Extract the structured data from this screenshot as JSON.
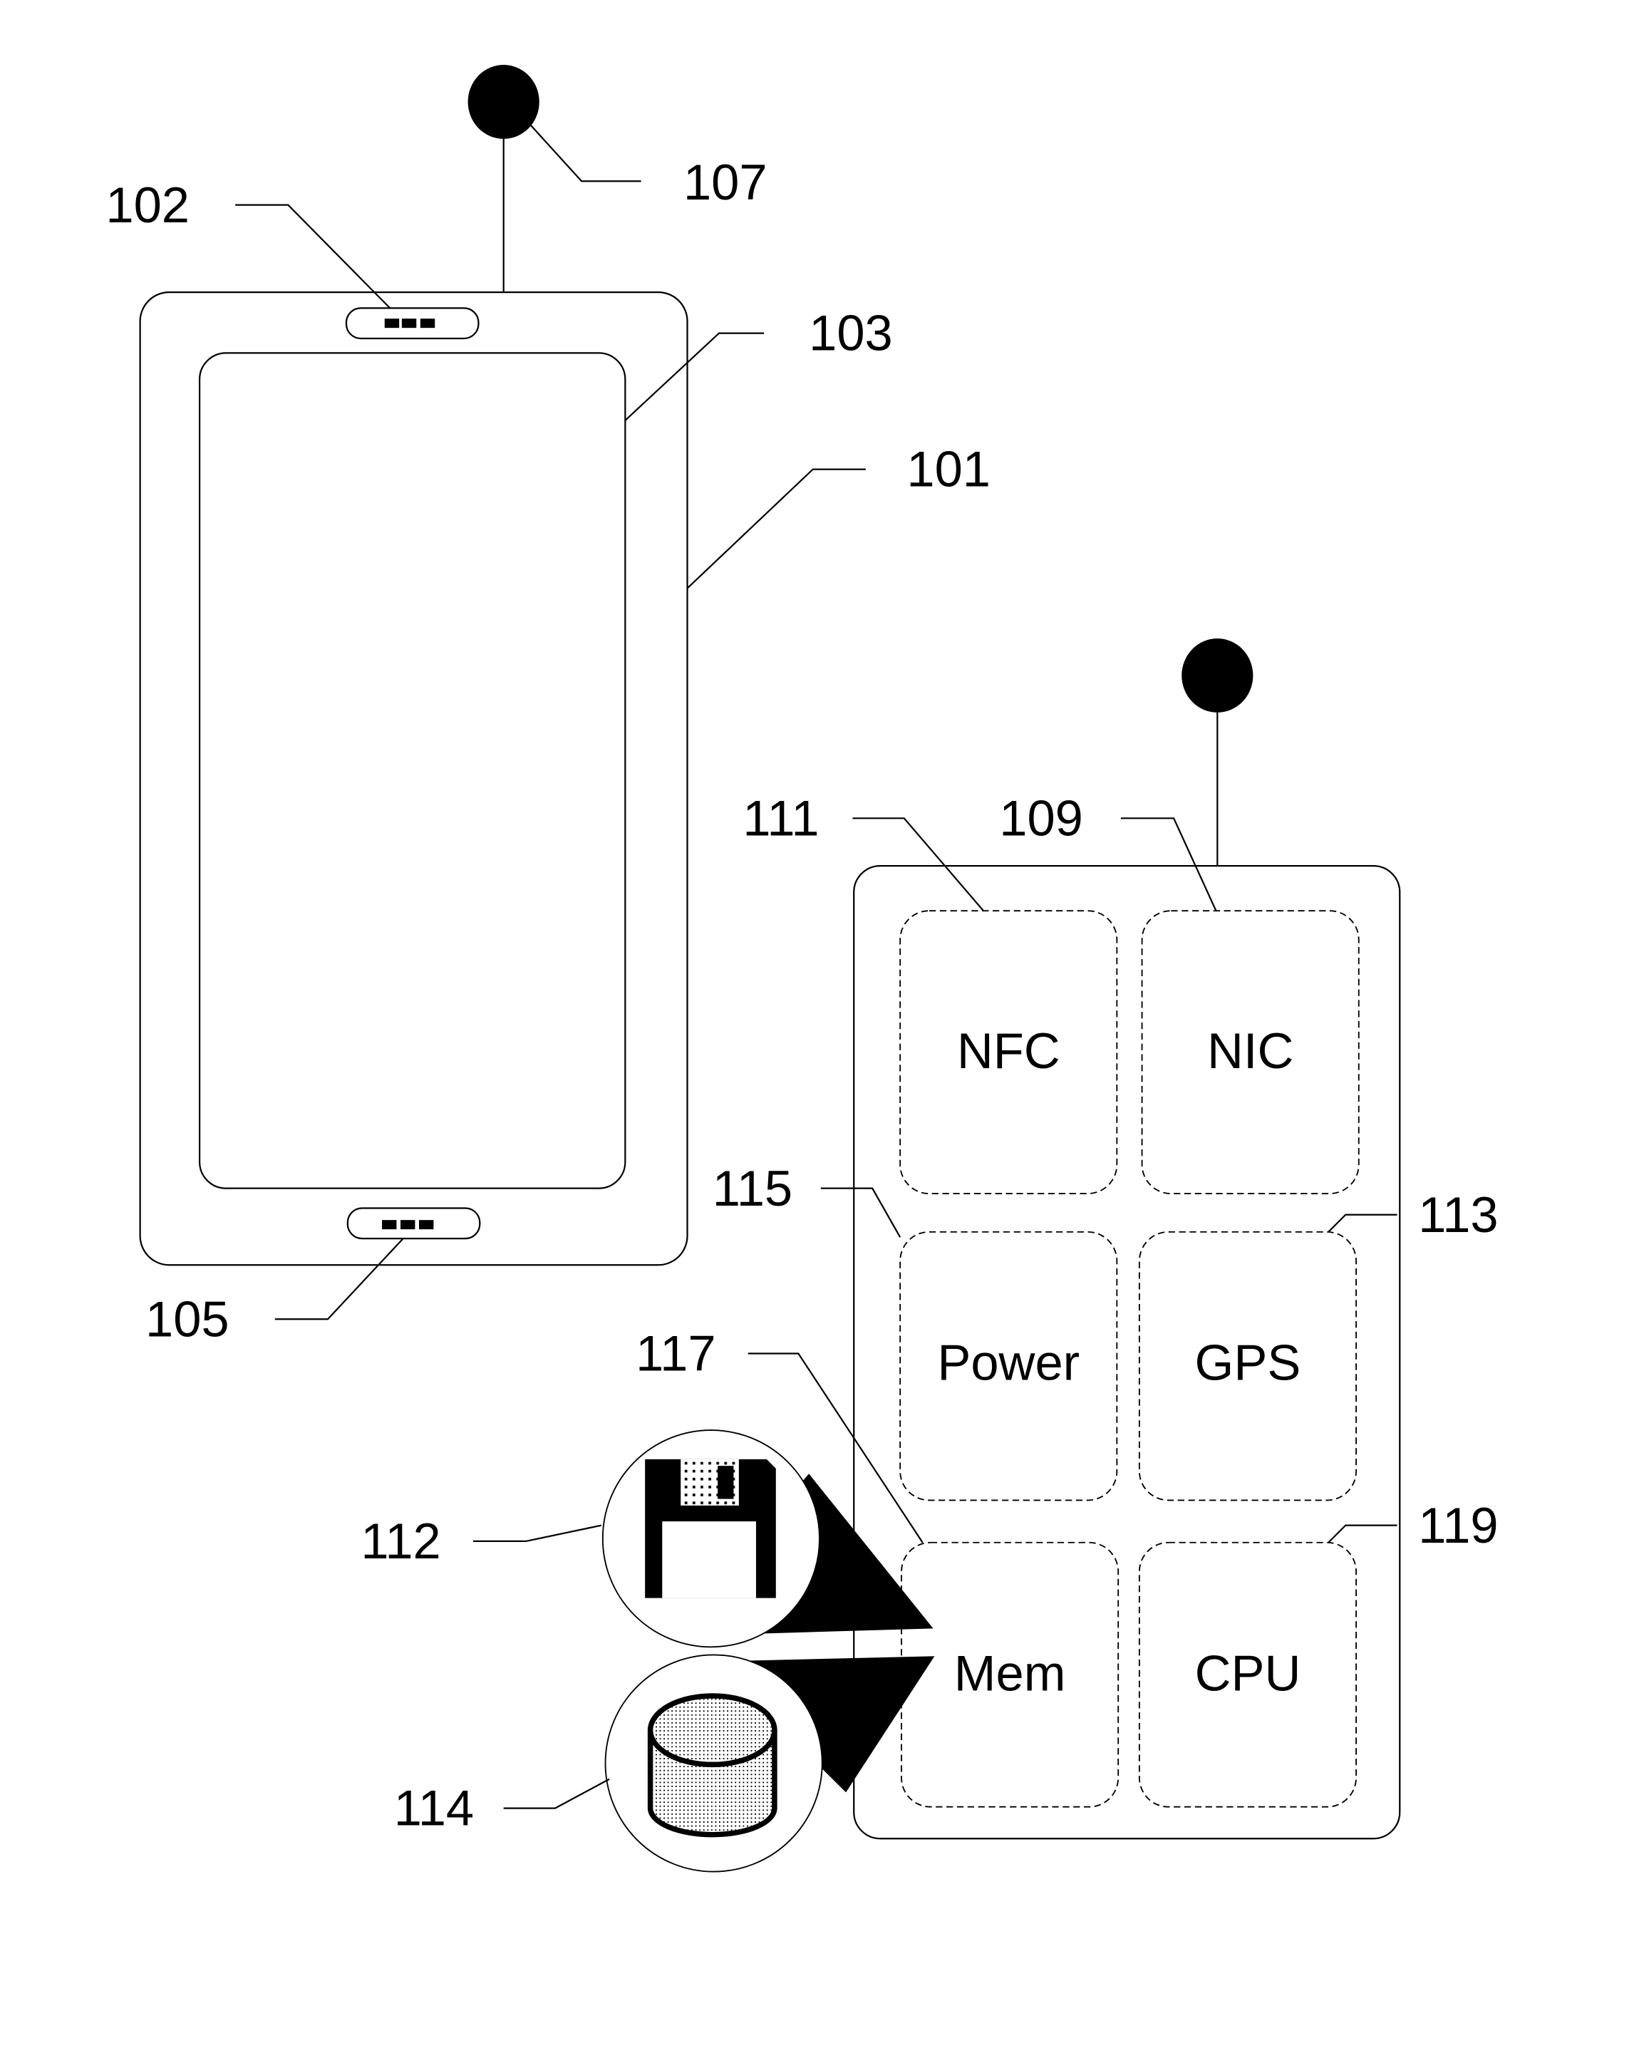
{
  "figure": {
    "device": {
      "body_ref": "101",
      "top_port_ref": "102",
      "screen_ref": "103",
      "bottom_port_ref": "105",
      "antenna_ref": "107"
    },
    "module": {
      "components": [
        {
          "ref": "111",
          "label": "NFC"
        },
        {
          "ref": "109",
          "label": "NIC"
        },
        {
          "ref": "115",
          "label": "Power"
        },
        {
          "ref": "113",
          "label": "GPS"
        },
        {
          "ref": "117",
          "label": "Mem"
        },
        {
          "ref": "119",
          "label": "CPU"
        }
      ]
    },
    "memory_callouts": [
      {
        "ref": "112",
        "icon": "floppy-disk-icon"
      },
      {
        "ref": "114",
        "icon": "storage-cylinder-icon"
      }
    ]
  }
}
